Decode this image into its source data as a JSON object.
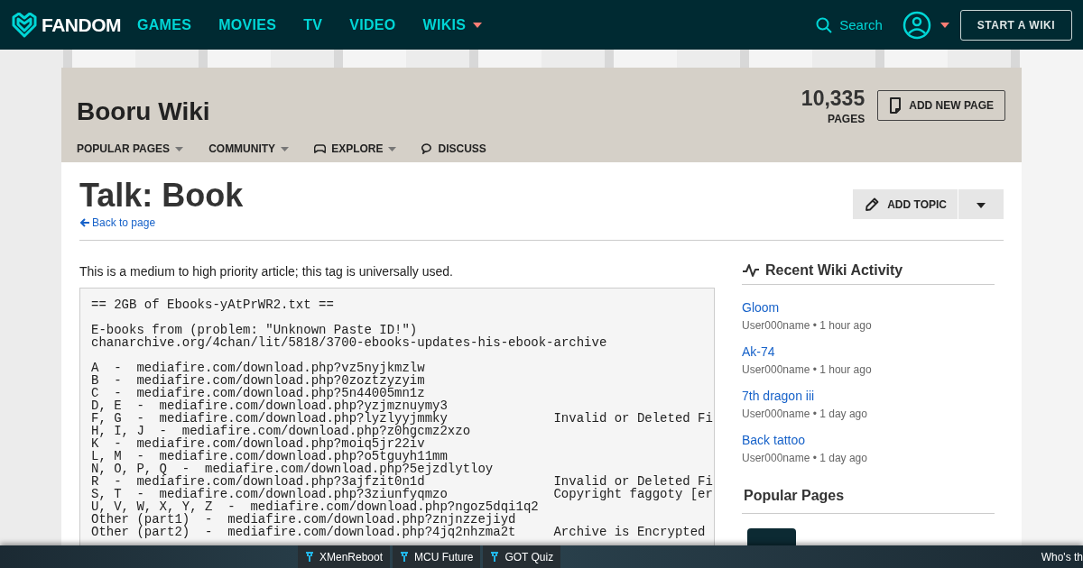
{
  "top_nav": {
    "logo": "FANDOM",
    "links": [
      {
        "label": "GAMES",
        "dropdown": false
      },
      {
        "label": "MOVIES",
        "dropdown": false
      },
      {
        "label": "TV",
        "dropdown": false
      },
      {
        "label": "VIDEO",
        "dropdown": false
      },
      {
        "label": "WIKIS",
        "dropdown": true
      }
    ],
    "search": "Search",
    "start_button": "START A WIKI"
  },
  "wiki_header": {
    "title": "Booru Wiki",
    "page_count": "10,335",
    "page_label": "PAGES",
    "add_button": "ADD NEW PAGE",
    "menu": [
      {
        "label": "POPULAR PAGES",
        "kind": "dropdown"
      },
      {
        "label": "COMMUNITY",
        "kind": "dropdown"
      },
      {
        "label": "EXPLORE",
        "kind": "explore"
      },
      {
        "label": "DISCUSS",
        "kind": "discuss"
      }
    ]
  },
  "page": {
    "title": "Talk: Book",
    "back_link": "Back to page",
    "add_topic": "ADD TOPIC",
    "intro": "This is a medium to high priority article; this tag is universally used.",
    "code_paragraphs": [
      [
        {
          "code": "== 2GB of Ebooks-yAtPrWR2.txt =="
        }
      ],
      [
        {
          "code": "E-books from (problem: \"Unknown Paste ID!\")"
        },
        {
          "code": "chanarchive.org/4chan/lit/5818/3700-ebooks-updates-his-ebook-archive"
        }
      ],
      [
        {
          "code": "A  -  mediafire.com/download.php?vz5nyjkmzlw"
        },
        {
          "code": "B  -  mediafire.com/download.php?0zoztzyzyim"
        },
        {
          "code": "C  -  mediafire.com/download.php?5n44005mn1z"
        },
        {
          "code": "D, E  -  mediafire.com/download.php?yzjmznuymy3"
        },
        {
          "code": "F, G  -  mediafire.com/download.php?lyzlyyjmmky",
          "note": "Invalid or Deleted Fi"
        },
        {
          "code": "H, I, J  -  mediafire.com/download.php?z0hgcmz2xzo"
        },
        {
          "code": "K  -  mediafire.com/download.php?moiq5jr22iv"
        },
        {
          "code": "L, M  -  mediafire.com/download.php?o5tguyh11mm"
        },
        {
          "code": "N, O, P, Q  -  mediafire.com/download.php?5ejzdlytloy"
        },
        {
          "code": "R  -  mediafire.com/download.php?3ajfzit0n1d",
          "note": "Invalid or Deleted Fi"
        },
        {
          "code": "S, T  -  mediafire.com/download.php?3ziunfyqmzo",
          "note": "Copyright faggoty [er"
        },
        {
          "code": "U, V, W, X, Y, Z  -  mediafire.com/download.php?ngoz5dqi1q2"
        },
        {
          "code": "Other (part1)  -  mediafire.com/download.php?znjnzzejiyd"
        },
        {
          "code": "Other (part2)  -  mediafire.com/download.php?4jq2nhzma2t",
          "note": "Archive is Encrypted"
        }
      ]
    ]
  },
  "sidebar": {
    "activity_title": "Recent Wiki Activity",
    "activity": [
      {
        "page": "Gloom",
        "meta": "User000name • 1 hour ago"
      },
      {
        "page": "Ak-74",
        "meta": "User000name • 1 hour ago"
      },
      {
        "page": "7th dragon iii",
        "meta": "User000name • 1 day ago"
      },
      {
        "page": "Back tattoo",
        "meta": "User000name • 1 day ago"
      }
    ],
    "popular_title": "Popular Pages"
  },
  "taskbar": {
    "items": [
      "XMenReboot",
      "MCU Future",
      "GOT Quiz"
    ],
    "right_text": "Who's th"
  }
}
